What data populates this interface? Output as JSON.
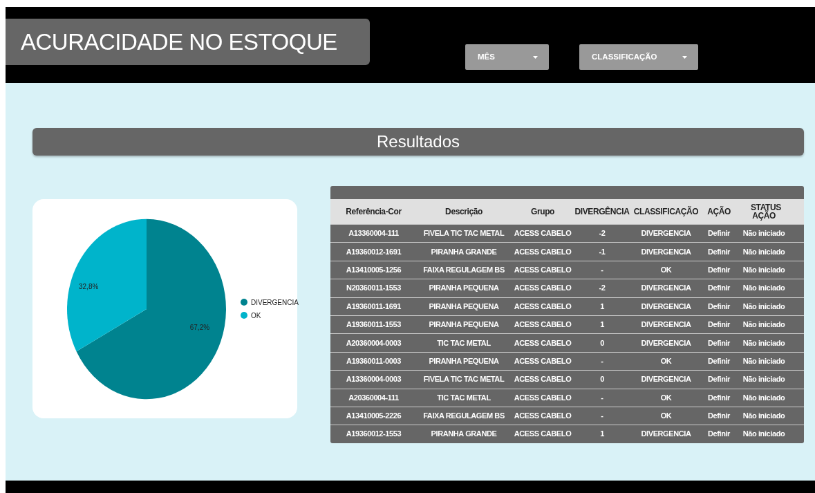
{
  "header": {
    "title": "ACURACIDADE NO ESTOQUE",
    "filters": [
      {
        "label": "MÊS"
      },
      {
        "label": "CLASSIFICAÇÃO"
      }
    ]
  },
  "section_title": "Resultados",
  "pie": {
    "chart_data": {
      "type": "pie",
      "categories": [
        "DIVERGENCIA",
        "OK"
      ],
      "values": [
        67.2,
        32.8
      ],
      "legend": "right",
      "colors": [
        "#00838f",
        "#00b4cb"
      ],
      "value_labels": [
        "67,2%",
        "32,8%"
      ]
    }
  },
  "table": {
    "columns": [
      "Referência-Cor",
      "Descrição",
      "Grupo",
      "DIVERGÊNCIA",
      "CLASSIFICAÇÃO",
      "AÇÃO",
      "STATUS AÇÃO"
    ],
    "rows": [
      [
        "A13360004-111",
        "FIVELA TIC TAC METAL",
        "ACESS CABELO",
        "-2",
        "DIVERGENCIA",
        "Definir",
        "Não iniciado"
      ],
      [
        "A19360012-1691",
        "PIRANHA GRANDE",
        "ACESS CABELO",
        "-1",
        "DIVERGENCIA",
        "Definir",
        "Não iniciado"
      ],
      [
        "A13410005-1256",
        "FAIXA REGULAGEM BS",
        "ACESS CABELO",
        "-",
        "OK",
        "Definir",
        "Não iniciado"
      ],
      [
        "N20360011-1553",
        "PIRANHA PEQUENA",
        "ACESS CABELO",
        "-2",
        "DIVERGENCIA",
        "Definir",
        "Não iniciado"
      ],
      [
        "A19360011-1691",
        "PIRANHA PEQUENA",
        "ACESS CABELO",
        "1",
        "DIVERGENCIA",
        "Definir",
        "Não iniciado"
      ],
      [
        "A19360011-1553",
        "PIRANHA PEQUENA",
        "ACESS CABELO",
        "1",
        "DIVERGENCIA",
        "Definir",
        "Não iniciado"
      ],
      [
        "A20360004-0003",
        "TIC TAC METAL",
        "ACESS CABELO",
        "0",
        "DIVERGENCIA",
        "Definir",
        "Não iniciado"
      ],
      [
        "A19360011-0003",
        "PIRANHA PEQUENA",
        "ACESS CABELO",
        "-",
        "OK",
        "Definir",
        "Não iniciado"
      ],
      [
        "A13360004-0003",
        "FIVELA TIC TAC METAL",
        "ACESS CABELO",
        "0",
        "DIVERGENCIA",
        "Definir",
        "Não iniciado"
      ],
      [
        "A20360004-111",
        "TIC TAC METAL",
        "ACESS CABELO",
        "-",
        "OK",
        "Definir",
        "Não iniciado"
      ],
      [
        "A13410005-2226",
        "FAIXA REGULAGEM BS",
        "ACESS CABELO",
        "-",
        "OK",
        "Definir",
        "Não iniciado"
      ],
      [
        "A19360012-1553",
        "PIRANHA GRANDE",
        "ACESS CABELO",
        "1",
        "DIVERGENCIA",
        "Definir",
        "Não iniciado"
      ]
    ]
  }
}
